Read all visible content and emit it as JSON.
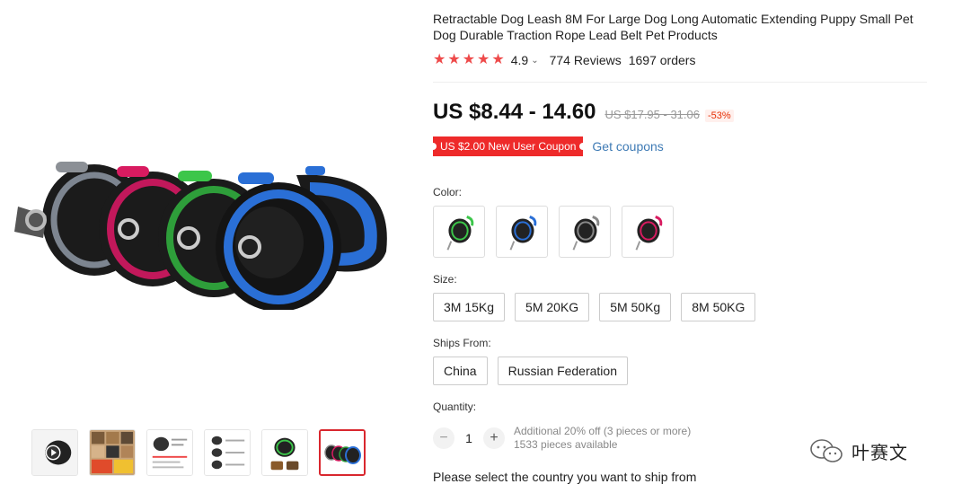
{
  "product": {
    "title": "Retractable Dog Leash 8M For Large Dog Long Automatic Extending Puppy Small Pet Dog Durable Traction Rope Lead Belt Pet Products",
    "rating": "4.9",
    "reviews": "774 Reviews",
    "orders": "1697 orders",
    "star_count": 5
  },
  "pricing": {
    "price": "US $8.44 - 14.60",
    "original_price": "US $17.95 - 31.06",
    "discount": "-53%"
  },
  "coupon": {
    "label": "US $2.00 New User Coupon",
    "link": "Get coupons"
  },
  "color": {
    "label": "Color:",
    "options": [
      "green",
      "blue",
      "grey",
      "pink"
    ]
  },
  "size": {
    "label": "Size:",
    "options": [
      "3M 15Kg",
      "5M 20KG",
      "5M 50Kg",
      "8M 50KG"
    ]
  },
  "ships_from": {
    "label": "Ships From:",
    "options": [
      "China",
      "Russian Federation"
    ]
  },
  "quantity": {
    "label": "Quantity:",
    "value": "1",
    "minus": "−",
    "plus": "+",
    "note_line1": "Additional 20% off (3 pieces or more)",
    "note_line2": "1533 pieces available"
  },
  "shipping_prompt": "Please select the country you want to ship from",
  "watermark": {
    "text": "叶赛文"
  },
  "colors": {
    "accent_red": "#ee4a4a",
    "coupon_red": "#ee2a2a",
    "link_blue": "#3f7bb5"
  }
}
